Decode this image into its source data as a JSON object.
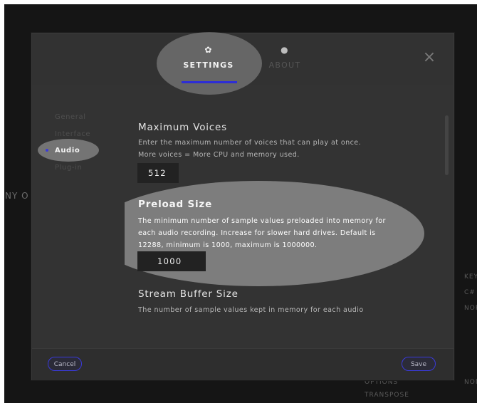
{
  "tabs": [
    {
      "label": "SETTINGS",
      "icon": "gear-icon"
    },
    {
      "label": "ABOUT",
      "icon": "info-icon"
    }
  ],
  "sidebar": {
    "items": [
      {
        "label": "General"
      },
      {
        "label": "Interface"
      },
      {
        "label": "Audio"
      },
      {
        "label": "Plug-in"
      }
    ],
    "active": "Audio"
  },
  "sections": {
    "max_voices": {
      "title": "Maximum Voices",
      "desc_line1": "Enter the maximum number of voices that can play at once.",
      "desc_line2": "More voices = More CPU and memory used.",
      "value": "512"
    },
    "preload": {
      "title": "Preload Size",
      "desc_line1": "The minimum number of sample values preloaded into memory for",
      "desc_line2": "each audio recording. Increase for slower hard drives. Default is",
      "desc_line3": "12288, minimum is 1000, maximum is 1000000.",
      "value": "1000"
    },
    "stream_buffer": {
      "title": "Stream Buffer Size",
      "desc_line1": "The number of sample values kept in memory for each audio"
    }
  },
  "footer": {
    "cancel_label": "Cancel",
    "save_label": "Save"
  },
  "background": {
    "left_text": "NY O",
    "right_key": "KEY",
    "right_c": "C#",
    "right_nor": "NOR",
    "right_non": "NON",
    "options": "OPTIONS",
    "transpose": "TRANSPOSE"
  },
  "colors": {
    "accent": "#2d2dd6",
    "modal_bg": "#333333",
    "input_bg": "#222222"
  }
}
